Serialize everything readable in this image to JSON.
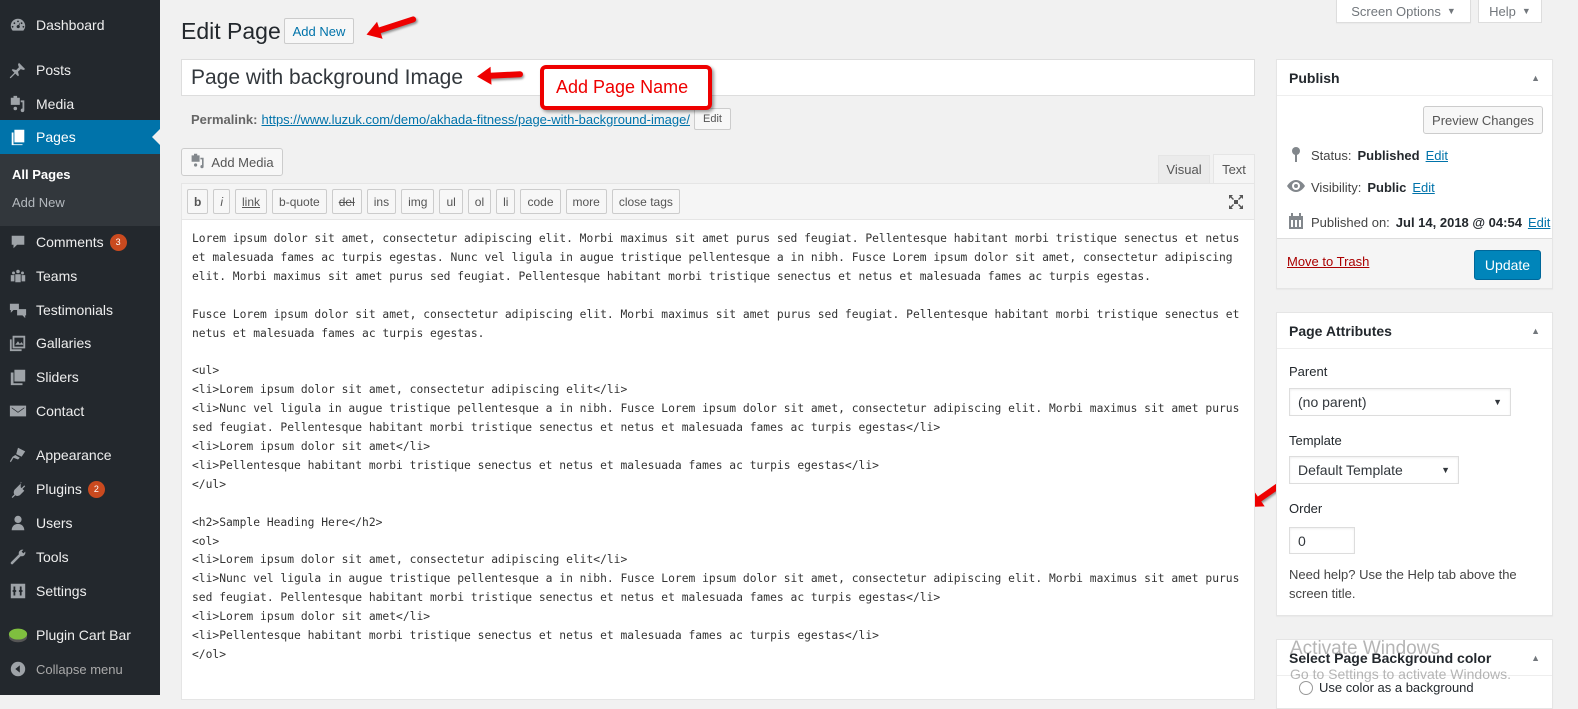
{
  "sidebar": {
    "items": [
      {
        "label": "Dashboard",
        "icon": "dashboard-icon"
      },
      {
        "label": "Posts",
        "icon": "pin-icon"
      },
      {
        "label": "Media",
        "icon": "media-icon"
      },
      {
        "label": "Pages",
        "icon": "pages-icon",
        "active": true
      },
      {
        "label": "Comments",
        "icon": "comment-icon",
        "badge": "3"
      },
      {
        "label": "Teams",
        "icon": "groups-icon"
      },
      {
        "label": "Testimonials",
        "icon": "testimonial-icon"
      },
      {
        "label": "Gallaries",
        "icon": "gallery-icon"
      },
      {
        "label": "Sliders",
        "icon": "slides-icon"
      },
      {
        "label": "Contact",
        "icon": "email-icon"
      },
      {
        "label": "Appearance",
        "icon": "brush-icon"
      },
      {
        "label": "Plugins",
        "icon": "plugin-icon",
        "badge": "2"
      },
      {
        "label": "Users",
        "icon": "user-icon"
      },
      {
        "label": "Tools",
        "icon": "wrench-icon"
      },
      {
        "label": "Settings",
        "icon": "settings-icon"
      },
      {
        "label": "Plugin Cart Bar",
        "icon": "pie-chart-icon"
      }
    ],
    "submenu": [
      "All Pages",
      "Add New"
    ],
    "collapse_label": "Collapse menu"
  },
  "header": {
    "screen_options": "Screen Options",
    "help": "Help",
    "title": "Edit Page",
    "add_new": "Add New"
  },
  "post": {
    "title": "Page with background Image",
    "permalink_label": "Permalink:",
    "permalink_url": "https://www.luzuk.com/demo/akhada-fitness/page-with-background-image/",
    "permalink_edit": "Edit"
  },
  "annotation": {
    "text": "Add Page Name",
    "color": "#e00000"
  },
  "editor": {
    "add_media": "Add Media",
    "tabs": {
      "visual": "Visual",
      "text": "Text",
      "active": "Text"
    },
    "quicktags": [
      "b",
      "i",
      "link",
      "b-quote",
      "del",
      "ins",
      "img",
      "ul",
      "ol",
      "li",
      "code",
      "more",
      "close tags"
    ],
    "content": "Lorem ipsum dolor sit amet, consectetur adipiscing elit. Morbi maximus sit amet purus sed feugiat. Pellentesque habitant morbi tristique senectus et netus et malesuada fames ac turpis egestas. Nunc vel ligula in augue tristique pellentesque a in nibh. Fusce Lorem ipsum dolor sit amet, consectetur adipiscing elit. Morbi maximus sit amet purus sed feugiat. Pellentesque habitant morbi tristique senectus et netus et malesuada fames ac turpis egestas.\n\nFusce Lorem ipsum dolor sit amet, consectetur adipiscing elit. Morbi maximus sit amet purus sed feugiat. Pellentesque habitant morbi tristique senectus et netus et malesuada fames ac turpis egestas.\n\n<ul>\n<li>Lorem ipsum dolor sit amet, consectetur adipiscing elit</li>\n<li>Nunc vel ligula in augue tristique pellentesque a in nibh. Fusce Lorem ipsum dolor sit amet, consectetur adipiscing elit. Morbi maximus sit amet purus sed feugiat. Pellentesque habitant morbi tristique senectus et netus et malesuada fames ac turpis egestas</li>\n<li>Lorem ipsum dolor sit amet</li>\n<li>Pellentesque habitant morbi tristique senectus et netus et malesuada fames ac turpis egestas</li>\n</ul>\n\n<h2>Sample Heading Here</h2>\n<ol>\n<li>Lorem ipsum dolor sit amet, consectetur adipiscing elit</li>\n<li>Nunc vel ligula in augue tristique pellentesque a in nibh. Fusce Lorem ipsum dolor sit amet, consectetur adipiscing elit. Morbi maximus sit amet purus sed feugiat. Pellentesque habitant morbi tristique senectus et netus et malesuada fames ac turpis egestas</li>\n<li>Lorem ipsum dolor sit amet</li>\n<li>Pellentesque habitant morbi tristique senectus et netus et malesuada fames ac turpis egestas</li>\n</ol>"
  },
  "publish": {
    "title": "Publish",
    "preview": "Preview Changes",
    "status_label": "Status:",
    "status_value": "Published",
    "visibility_label": "Visibility:",
    "visibility_value": "Public",
    "published_label": "Published on:",
    "published_value": "Jul 14, 2018 @ 04:54",
    "edit": "Edit",
    "trash": "Move to Trash",
    "update": "Update"
  },
  "attributes": {
    "title": "Page Attributes",
    "parent_label": "Parent",
    "parent_value": "(no parent)",
    "template_label": "Template",
    "template_value": "Default Template",
    "order_label": "Order",
    "order_value": "0",
    "help": "Need help? Use the Help tab above the screen title."
  },
  "bg_box": {
    "title": "Select Page Background color",
    "option": "Use color as a background"
  },
  "watermark": {
    "line1": "Activate Windows",
    "line2": "Go to Settings to activate Windows."
  }
}
